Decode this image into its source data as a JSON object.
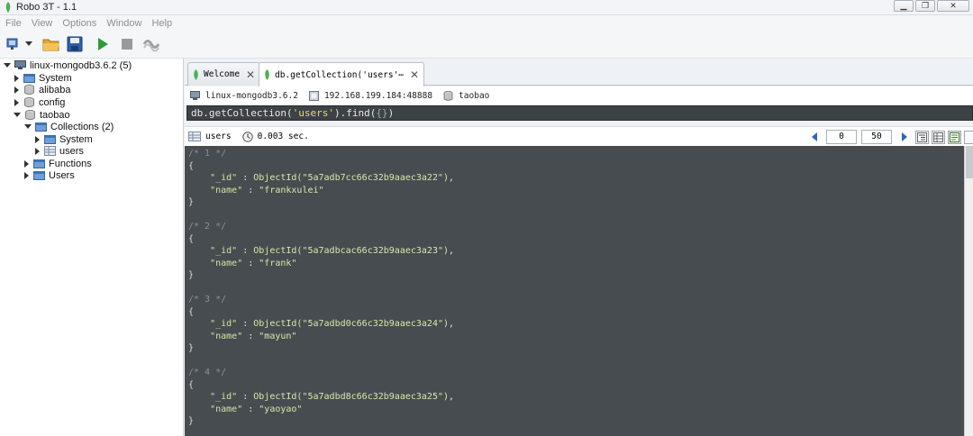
{
  "window": {
    "title": "Robo 3T - 1.1"
  },
  "menu": [
    "File",
    "View",
    "Options",
    "Window",
    "Help"
  ],
  "toolbar": {
    "icons": [
      "connect-icon",
      "open-icon",
      "save-icon",
      "execute-icon",
      "stop-icon",
      "format-icon"
    ]
  },
  "tree": {
    "root": "linux-mongodb3.6.2 (5)",
    "dbs": [
      "System",
      "alibaba",
      "config",
      "taobao"
    ],
    "collections_label": "Collections (2)",
    "collections": [
      "System",
      "users"
    ],
    "functions": "Functions",
    "users": "Users"
  },
  "tabs": [
    {
      "label": "Welcome"
    },
    {
      "label": "db.getCollection('users'⋯"
    }
  ],
  "connection": {
    "server": "linux-mongodb3.6.2",
    "address": "192.168.199.184:48888",
    "database": "taobao"
  },
  "query": {
    "prefix": "db.getCollection(",
    "arg": "'users'",
    "suffix": ").find(",
    "inner": "{}",
    "end": ")"
  },
  "result": {
    "collection": "users",
    "time": "0.003 sec.",
    "skip": "0",
    "limit": "50"
  },
  "documents": [
    {
      "header": "/* 1 */",
      "id_key": "\"_id\"",
      "id_val": "ObjectId(\"5a7adb7cc66c32b9aaec3a22\")",
      "name_key": "\"name\"",
      "name_val": "\"frankxulei\""
    },
    {
      "header": "/* 2 */",
      "id_key": "\"_id\"",
      "id_val": "ObjectId(\"5a7adbcac66c32b9aaec3a23\")",
      "name_key": "\"name\"",
      "name_val": "\"frank\""
    },
    {
      "header": "/* 3 */",
      "id_key": "\"_id\"",
      "id_val": "ObjectId(\"5a7adbd0c66c32b9aaec3a24\")",
      "name_key": "\"name\"",
      "name_val": "\"mayun\""
    },
    {
      "header": "/* 4 */",
      "id_key": "\"_id\"",
      "id_val": "ObjectId(\"5a7adbd8c66c32b9aaec3a25\")",
      "name_key": "\"name\"",
      "name_val": "\"yaoyao\""
    }
  ],
  "colors": {
    "resultsBg": "#474c51",
    "queryBg": "#3d4247",
    "mongoGreen": "#4caf50"
  }
}
